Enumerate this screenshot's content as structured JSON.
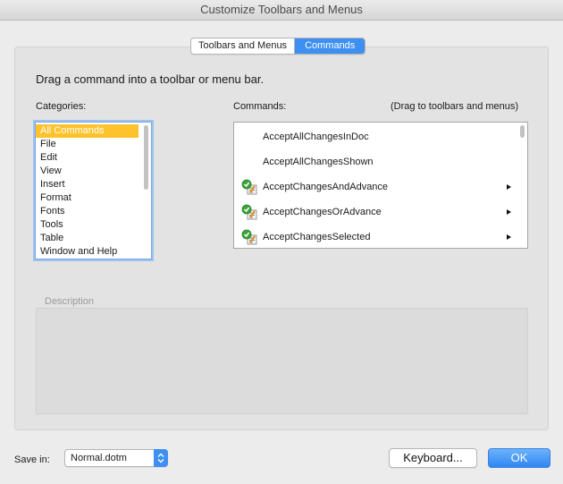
{
  "window": {
    "title": "Customize Toolbars and Menus"
  },
  "tabs": [
    {
      "label": "Toolbars and Menus",
      "active": false
    },
    {
      "label": "Commands",
      "active": true
    }
  ],
  "instruction": "Drag a command into a toolbar or menu bar.",
  "categories": {
    "label": "Categories:",
    "items": [
      "All Commands",
      "File",
      "Edit",
      "View",
      "Insert",
      "Format",
      "Fonts",
      "Tools",
      "Table",
      "Window and Help"
    ],
    "selected": "All Commands"
  },
  "commands": {
    "label": "Commands:",
    "hint": "(Drag to toolbars and menus)",
    "items": [
      {
        "label": "AcceptAllChangesInDoc",
        "icon": "none",
        "submenu": false
      },
      {
        "label": "AcceptAllChangesShown",
        "icon": "none",
        "submenu": false
      },
      {
        "label": "AcceptChangesAndAdvance",
        "icon": "accept-change-icon",
        "submenu": true
      },
      {
        "label": "AcceptChangesOrAdvance",
        "icon": "accept-change-icon",
        "submenu": true
      },
      {
        "label": "AcceptChangesSelected",
        "icon": "accept-change-icon",
        "submenu": true
      }
    ]
  },
  "description": {
    "label": "Description",
    "text": ""
  },
  "footer": {
    "save_in_label": "Save in:",
    "save_in_value": "Normal.dotm",
    "keyboard_label": "Keyboard...",
    "ok_label": "OK"
  },
  "colors": {
    "accent": "#3e8ff2",
    "selection": "#fdc22c",
    "focus_ring": "#9cc2f0"
  }
}
